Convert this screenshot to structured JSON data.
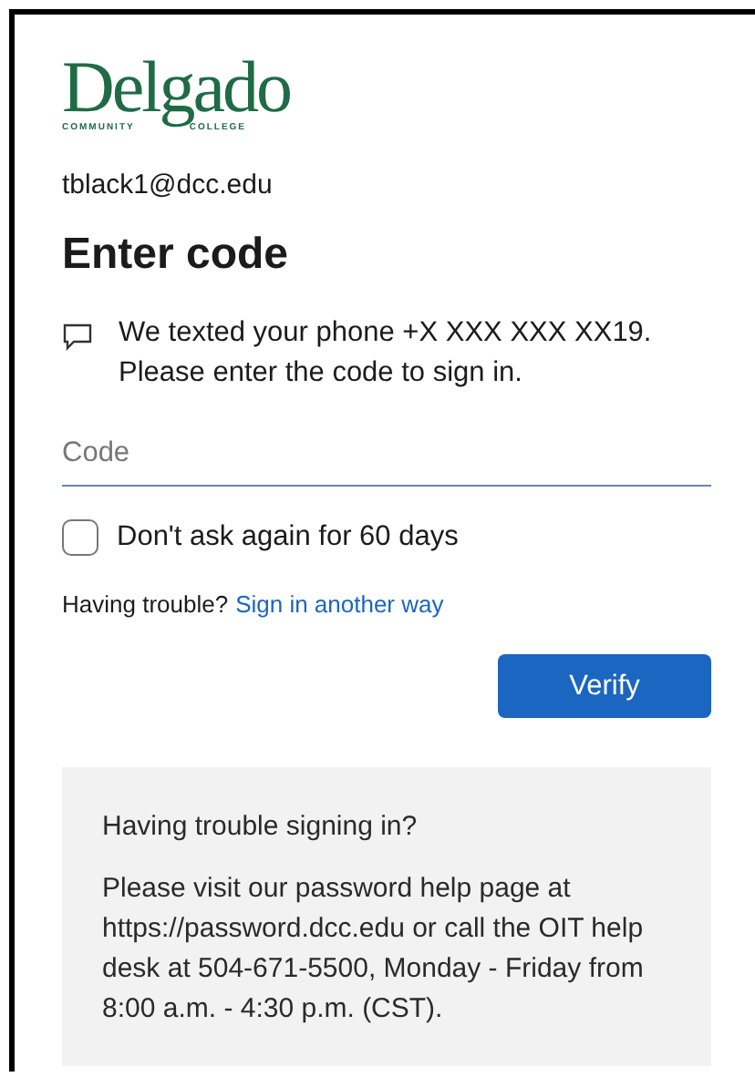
{
  "logo": {
    "name": "Delgado",
    "tagline_left": "COMMUNITY",
    "tagline_right": "COLLEGE"
  },
  "account": "tblack1@dcc.edu",
  "heading": "Enter code",
  "message": [
    "We texted your phone +X XXX XXX XX19.",
    "Please enter the code to sign in."
  ],
  "code_field": {
    "placeholder": "Code"
  },
  "remember": {
    "label": "Don't ask again for 60 days",
    "checked": false
  },
  "trouble": {
    "text": "Having trouble?",
    "link": "Sign in another way"
  },
  "verify_button": "Verify",
  "help": {
    "title": "Having trouble signing in?",
    "body": "Please visit our password help page at https://password.dcc.edu or call the OIT help desk at 504-671-5500, Monday - Friday from 8:00 a.m. - 4:30 p.m. (CST)."
  }
}
